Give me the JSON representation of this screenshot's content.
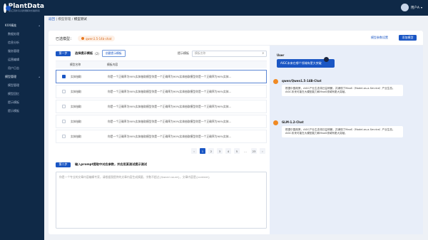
{
  "brand": {
    "name": "PlantData",
    "sub": "知识工程化与认知智能解决方案提供商"
  },
  "user": {
    "name": "用户A"
  },
  "sidebar": {
    "items": [
      {
        "label": "KXX精准",
        "type": "group"
      },
      {
        "label": "数据处理",
        "type": "sub"
      },
      {
        "label": "信息分析",
        "type": "sub"
      },
      {
        "label": "服务管理",
        "type": "sub"
      },
      {
        "label": "运营编辑",
        "type": "sub"
      },
      {
        "label": "用户日志",
        "type": "sub"
      },
      {
        "label": "模型管理",
        "type": "group"
      },
      {
        "label": "模型管理",
        "type": "sub"
      },
      {
        "label": "模型回忆",
        "type": "sub"
      },
      {
        "label": "提示模板",
        "type": "sub"
      },
      {
        "label": "提示模板",
        "type": "sub"
      }
    ]
  },
  "breadcrumb": {
    "root": "返回",
    "parent": "模型管理",
    "sep": "/",
    "current": "模型测试"
  },
  "model_bar": {
    "label": "已选模型：",
    "chip": "qwen1.5-14b-chat",
    "link": "模型参数设置",
    "button": "添加模型"
  },
  "step1": {
    "badge": "第一步",
    "title": "选择提示模板",
    "count": "(2)",
    "tag": "创建提示模板",
    "search_label": "提示模板",
    "search_placeholder": "模板名称",
    "headers": [
      "模型名称",
      "模板内容"
    ],
    "rows": [
      {
        "name": "实体抽取",
        "content": "你是一个正确率为90%实体抽取模型你是一个正确率为90%实体抽取模型你是一个正确率为90%实体...",
        "selected": true
      },
      {
        "name": "实体抽取",
        "content": "你是一个正确率为90%实体抽取模型你是一个正确率为90%实体抽取模型你是一个正确率为90%实体...",
        "selected": false
      },
      {
        "name": "实体抽取",
        "content": "你是一个正确率为90%实体抽取模型你是一个正确率为90%实体抽取模型你是一个正确率为90%实体...",
        "selected": false
      },
      {
        "name": "实体抽取",
        "content": "你是一个正确率为90%实体抽取模型你是一个正确率为90%实体抽取模型你是一个正确率为90%实体...",
        "selected": false
      },
      {
        "name": "实体抽取",
        "content": "你是一个正确率为90%实体抽取模型你是一个正确率为90%实体抽取模型你是一个正确率为90%实体...",
        "selected": false
      }
    ],
    "pager": {
      "prev": "‹",
      "pages": [
        "1",
        "2",
        "3",
        "4",
        "5",
        "...",
        "23"
      ],
      "next": "›"
    }
  },
  "step2": {
    "badge": "第二步",
    "title": "输入prompt提取中对应参数，并应用某测试提示测试",
    "textarea_placeholder": "你是一个专业的文章内容编辑专家，请根据我提供的文章内容生成摘要，字数不超过{$word count}，文章内容是{content}"
  },
  "chat": {
    "user": {
      "name": "User",
      "message": "AIGC未来在哪个领域有更大突破"
    },
    "answers": [
      {
        "name": "qwen/Qwen1.5-14B-Chat",
        "message": "根据中国政策，AIGC产业生态将日益明朗，并涌现了MaaS（Model-as-a-Service）产业生态。AIGC未来可能在大模型能力和MaaS领域有更大突破。"
      },
      {
        "name": "GLM-1.2-Chat",
        "message": "根据中国政策，AIGC产业生态将日益明朗，并涌现了MaaS（Model-as-a-Service）产业生态。AIGC未来可能在大模型能力和MaaS领域有更大突破。"
      }
    ]
  }
}
